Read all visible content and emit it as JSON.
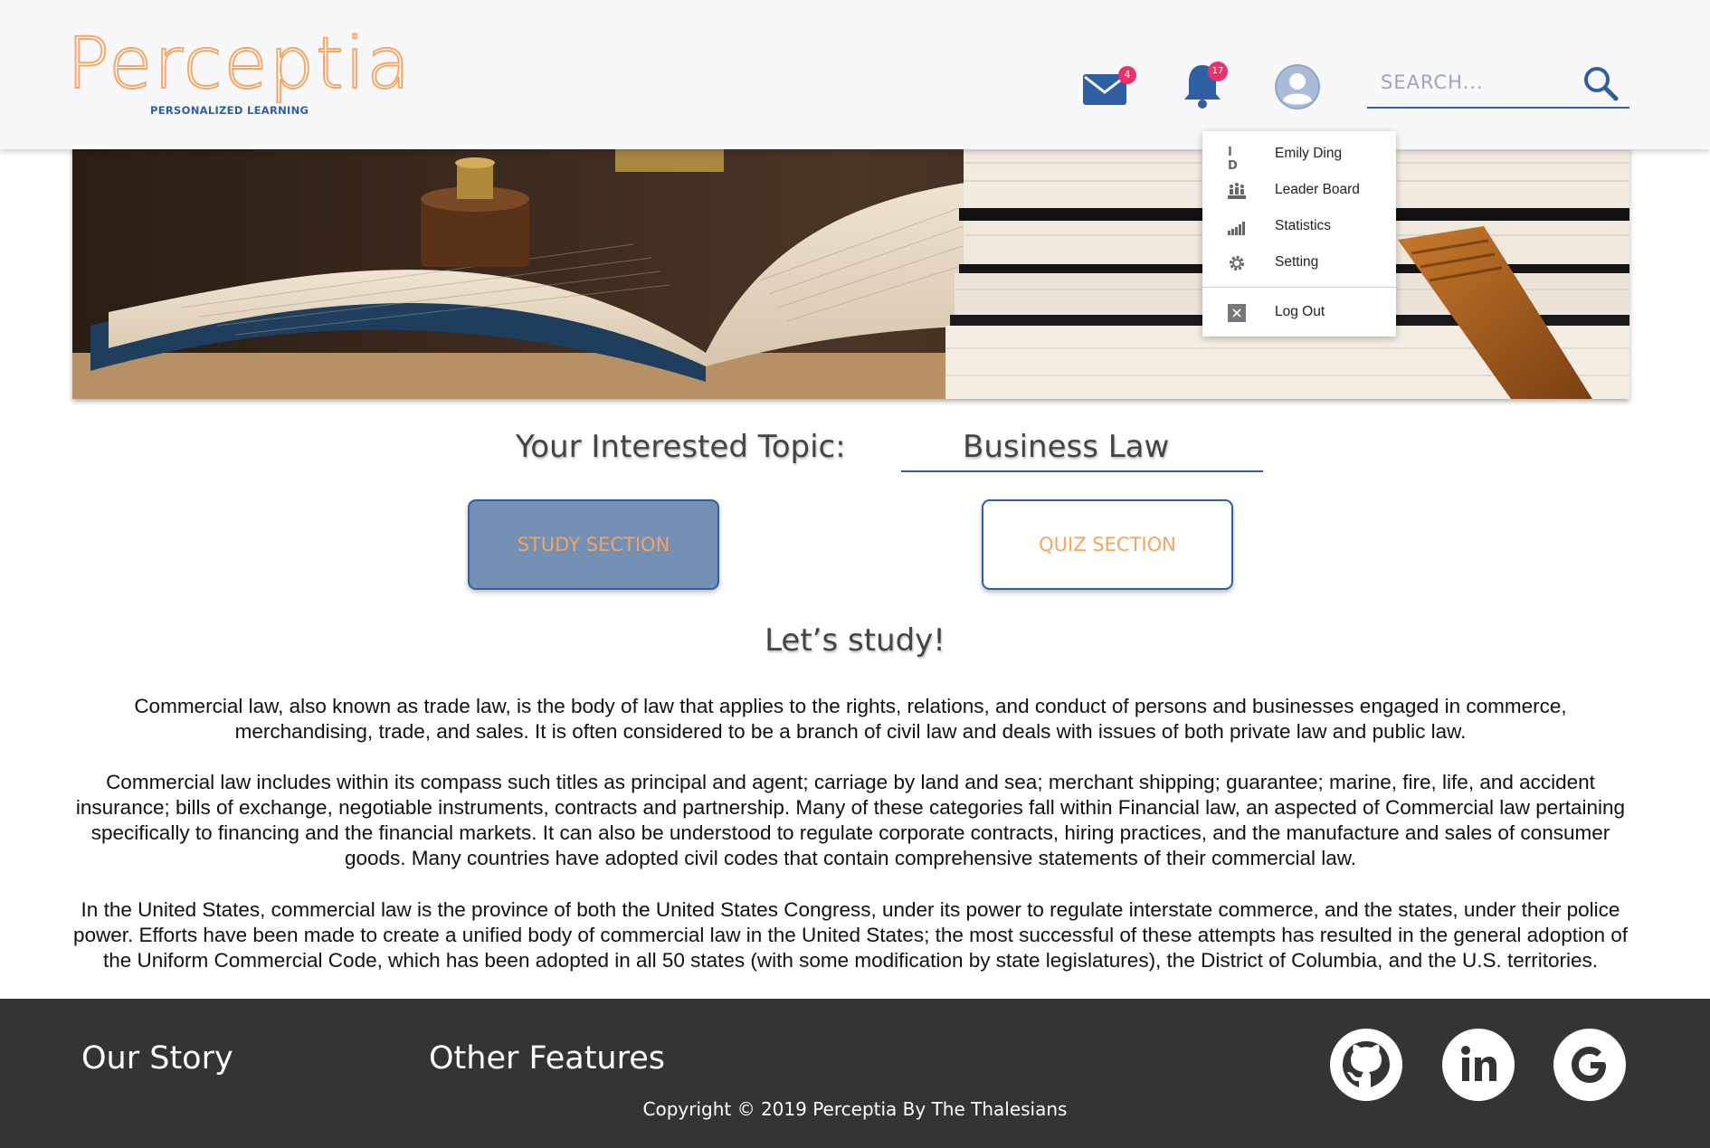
{
  "header": {
    "logo_text": "Perceptia",
    "logo_tagline": "PERSONALIZED LEARNING",
    "mail_count": "4",
    "notification_count": "17",
    "search_placeholder": "SEARCH..."
  },
  "user_menu": {
    "items": [
      {
        "icon": "id-icon",
        "label": "Emily Ding",
        "icon_text": "I D"
      },
      {
        "icon": "leaderboard-icon",
        "label": "Leader Board"
      },
      {
        "icon": "statistics-icon",
        "label": "Statistics"
      },
      {
        "icon": "settings-gear-icon",
        "label": "Setting"
      },
      {
        "icon": "logout-icon",
        "label": "Log Out"
      }
    ]
  },
  "topic": {
    "label": "Your Interested Topic:",
    "value": "Business Law"
  },
  "buttons": {
    "study": "STUDY SECTION",
    "quiz": "QUIZ SECTION"
  },
  "study": {
    "title": "Let’s study!",
    "paragraphs": [
      "Commercial law, also known as trade law, is the body of law that applies to the rights, relations, and conduct of persons and businesses engaged in commerce, merchandising, trade, and sales. It is often considered to be a branch of civil law and deals with issues of both private law and public law.",
      "Commercial law includes within its compass such titles as principal and agent; carriage by land and sea; merchant shipping; guarantee; marine, fire, life, and accident insurance; bills of exchange, negotiable instruments, contracts and partnership. Many of these categories fall within Financial law, an aspected of Commercial law pertaining specifically to financing and the financial markets. It can also be understood to regulate corporate contracts, hiring practices, and the manufacture and sales of consumer goods. Many countries have adopted civil codes that contain comprehensive statements of their commercial law.",
      "In the United States, commercial law is the province of both the United States Congress, under its power to regulate interstate commerce, and the states, under their police power. Efforts have been made to create a unified body of commercial law in the United States; the most successful of these attempts has resulted in the general adoption of the Uniform Commercial Code, which has been adopted in all 50 states (with some modification by state legislatures), the District of Columbia, and the U.S. territories."
    ]
  },
  "footer": {
    "links": [
      "Our Story",
      "Other Features"
    ],
    "copyright": "Copyright © 2019 Perceptia By The Thalesians",
    "social": [
      "github-icon",
      "linkedin-icon",
      "google-icon"
    ]
  },
  "colors": {
    "accent_orange": "#f3a86a",
    "brand_blue": "#2e5fa3",
    "badge_pink": "#e8336a",
    "footer_bg": "#343434",
    "study_button_bg": "#7490b5"
  }
}
